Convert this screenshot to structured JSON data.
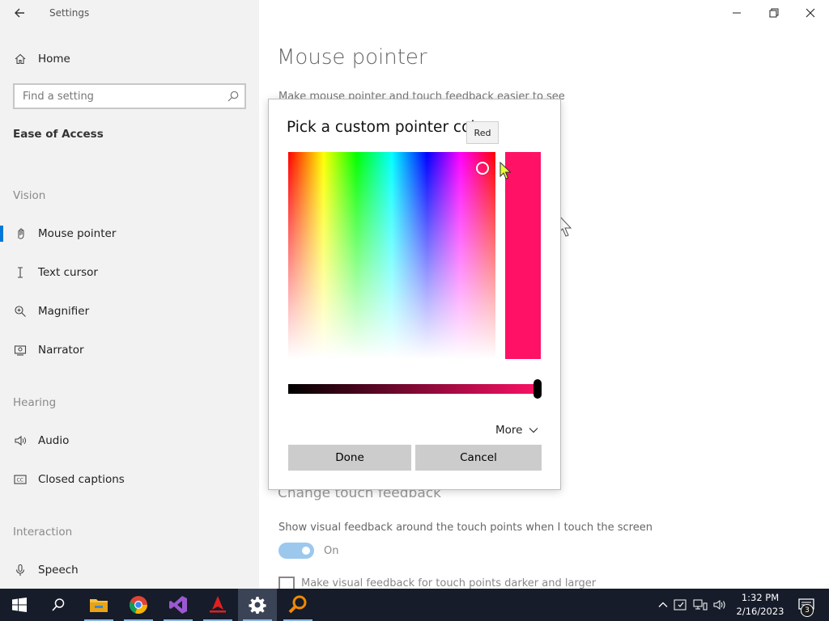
{
  "window": {
    "app_title": "Settings"
  },
  "nav": {
    "home_label": "Home",
    "search_placeholder": "Find a setting",
    "section_title": "Ease of Access",
    "groups": {
      "vision": "Vision",
      "hearing": "Hearing",
      "interaction": "Interaction"
    },
    "items": {
      "mouse_pointer": "Mouse pointer",
      "text_cursor": "Text cursor",
      "magnifier": "Magnifier",
      "narrator": "Narrator",
      "audio": "Audio",
      "closed_captions": "Closed captions",
      "speech": "Speech"
    },
    "selected": "mouse_pointer"
  },
  "main": {
    "title": "Mouse pointer",
    "description": "Make mouse pointer and touch feedback easier to see",
    "touch_heading": "Change touch feedback",
    "touch_description": "Show visual feedback around the touch points when I touch the screen",
    "touch_toggle_state": "On",
    "touch_checkbox_label": "Make visual feedback for touch points darker and larger"
  },
  "dialog": {
    "title": "Pick a custom pointer color",
    "preview_color": "#ff1166",
    "more_label": "More",
    "done_label": "Done",
    "cancel_label": "Cancel"
  },
  "tooltip": {
    "text": "Red"
  },
  "taskbar": {
    "time": "1:32 PM",
    "date": "2/16/2023",
    "notification_count": "3",
    "apps": [
      "start-icon",
      "search-icon",
      "file-explorer-icon",
      "chrome-icon",
      "visual-studio-icon",
      "red-arrow-app-icon",
      "settings-gear-icon",
      "magnifier-app-icon"
    ]
  },
  "colors": {
    "accent": "#0078d7",
    "button_gray": "#cccccc",
    "taskbar": "#161c2a"
  }
}
